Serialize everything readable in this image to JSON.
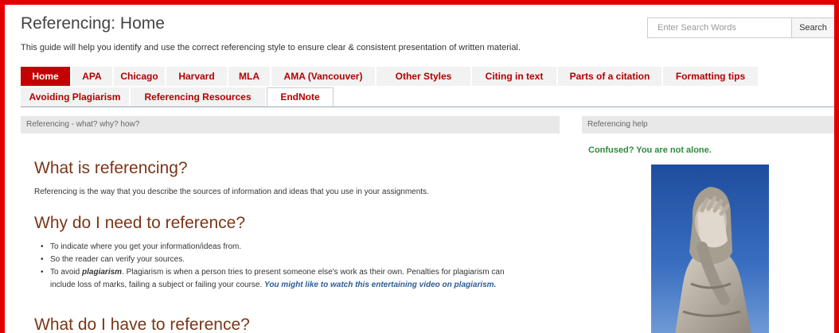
{
  "header": {
    "title": "Referencing: Home",
    "intro": "This guide will help you identify and use the correct referencing style to ensure clear & consistent presentation of written material."
  },
  "search": {
    "placeholder": "Enter Search Words",
    "button_label": "Search"
  },
  "tabs_row1": [
    {
      "label": "Home",
      "active": true
    },
    {
      "label": "APA"
    },
    {
      "label": "Chicago"
    },
    {
      "label": "Harvard"
    },
    {
      "label": "MLA"
    },
    {
      "label": "AMA (Vancouver)"
    },
    {
      "label": "Other Styles"
    },
    {
      "label": "Citing in text"
    },
    {
      "label": "Parts of a citation"
    },
    {
      "label": "Formatting tips"
    }
  ],
  "tabs_row2": [
    {
      "label": "Avoiding Plagiarism"
    },
    {
      "label": "Referencing Resources"
    },
    {
      "label": "EndNote"
    }
  ],
  "main_panel": {
    "header": "Referencing - what? why? how?",
    "h_what": "What is referencing?",
    "p_what": "Referencing is the way that you describe the sources of information and ideas that you use in your assignments.",
    "h_why": "Why do I need to reference?",
    "why_items": [
      "To indicate where you get your information/ideas from.",
      "So the reader can verify your sources."
    ],
    "why_item3_pre": "To avoid ",
    "why_item3_word": "plagiarism",
    "why_item3_mid": ".  Plagiarism is when a person tries to present someone else's work as their own.  Penalties for plagiarism can",
    "why_item3_cont": "include loss of marks, failing a subject or failing your course. ",
    "why_item3_link": "You might like to watch this entertaining video on plagiarism",
    "why_item3_end": ".",
    "h_what_do": "What do I have to reference?"
  },
  "side_panel": {
    "header": "Referencing help",
    "note": "Confused? You are not alone."
  },
  "colors": {
    "frame": "#e00000",
    "tab_active_bg": "#c40000",
    "tab_text": "#b30000",
    "heading": "#7a3618",
    "link": "#2a5c98",
    "note": "#2e8b3d"
  }
}
